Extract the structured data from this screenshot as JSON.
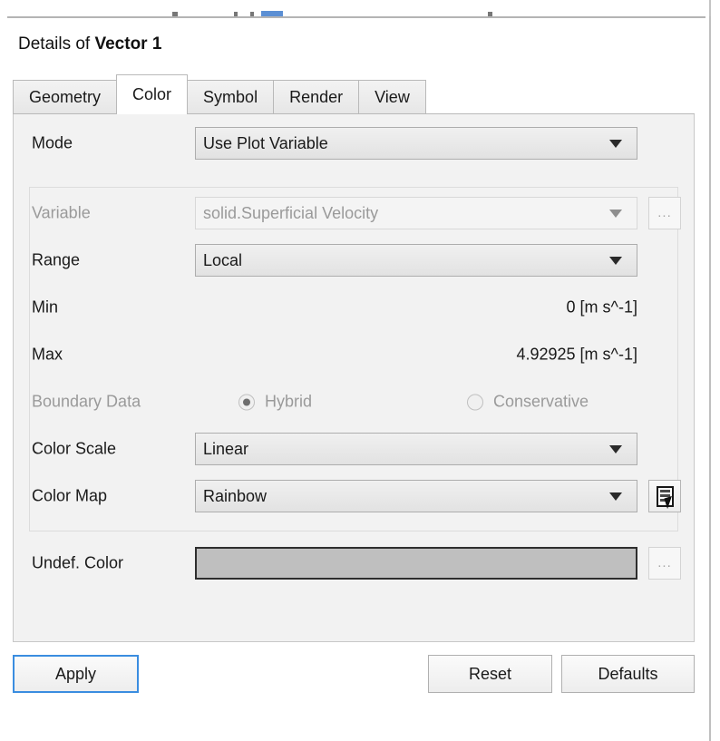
{
  "window": {
    "title_prefix": "Details of ",
    "title_object": "Vector 1",
    "accent_focus_color": "#3a8de0",
    "panel_background": "#f2f2f2"
  },
  "tabs": [
    {
      "label": "Geometry",
      "active": false
    },
    {
      "label": "Color",
      "active": true
    },
    {
      "label": "Symbol",
      "active": false
    },
    {
      "label": "Render",
      "active": false
    },
    {
      "label": "View",
      "active": false
    }
  ],
  "form": {
    "mode": {
      "label": "Mode",
      "value": "Use Plot Variable",
      "enabled": true
    },
    "variable": {
      "label": "Variable",
      "value": "solid.Superficial Velocity",
      "enabled": false,
      "aux_button_label": "..."
    },
    "range": {
      "label": "Range",
      "value": "Local",
      "enabled": true
    },
    "min": {
      "label": "Min",
      "value": "0 [m s^-1]"
    },
    "max": {
      "label": "Max",
      "value": "4.92925 [m s^-1]"
    },
    "boundary_data": {
      "label": "Boundary Data",
      "enabled": false,
      "options": [
        {
          "label": "Hybrid",
          "selected": true
        },
        {
          "label": "Conservative",
          "selected": false
        }
      ]
    },
    "color_scale": {
      "label": "Color Scale",
      "value": "Linear",
      "enabled": true
    },
    "color_map": {
      "label": "Color Map",
      "value": "Rainbow",
      "enabled": true,
      "aux_icon": "colormap-editor-icon"
    },
    "undef_color": {
      "label": "Undef. Color",
      "swatch_color": "#bfbfbf",
      "aux_button_label": "..."
    }
  },
  "buttons": {
    "apply": "Apply",
    "reset": "Reset",
    "defaults": "Defaults"
  }
}
